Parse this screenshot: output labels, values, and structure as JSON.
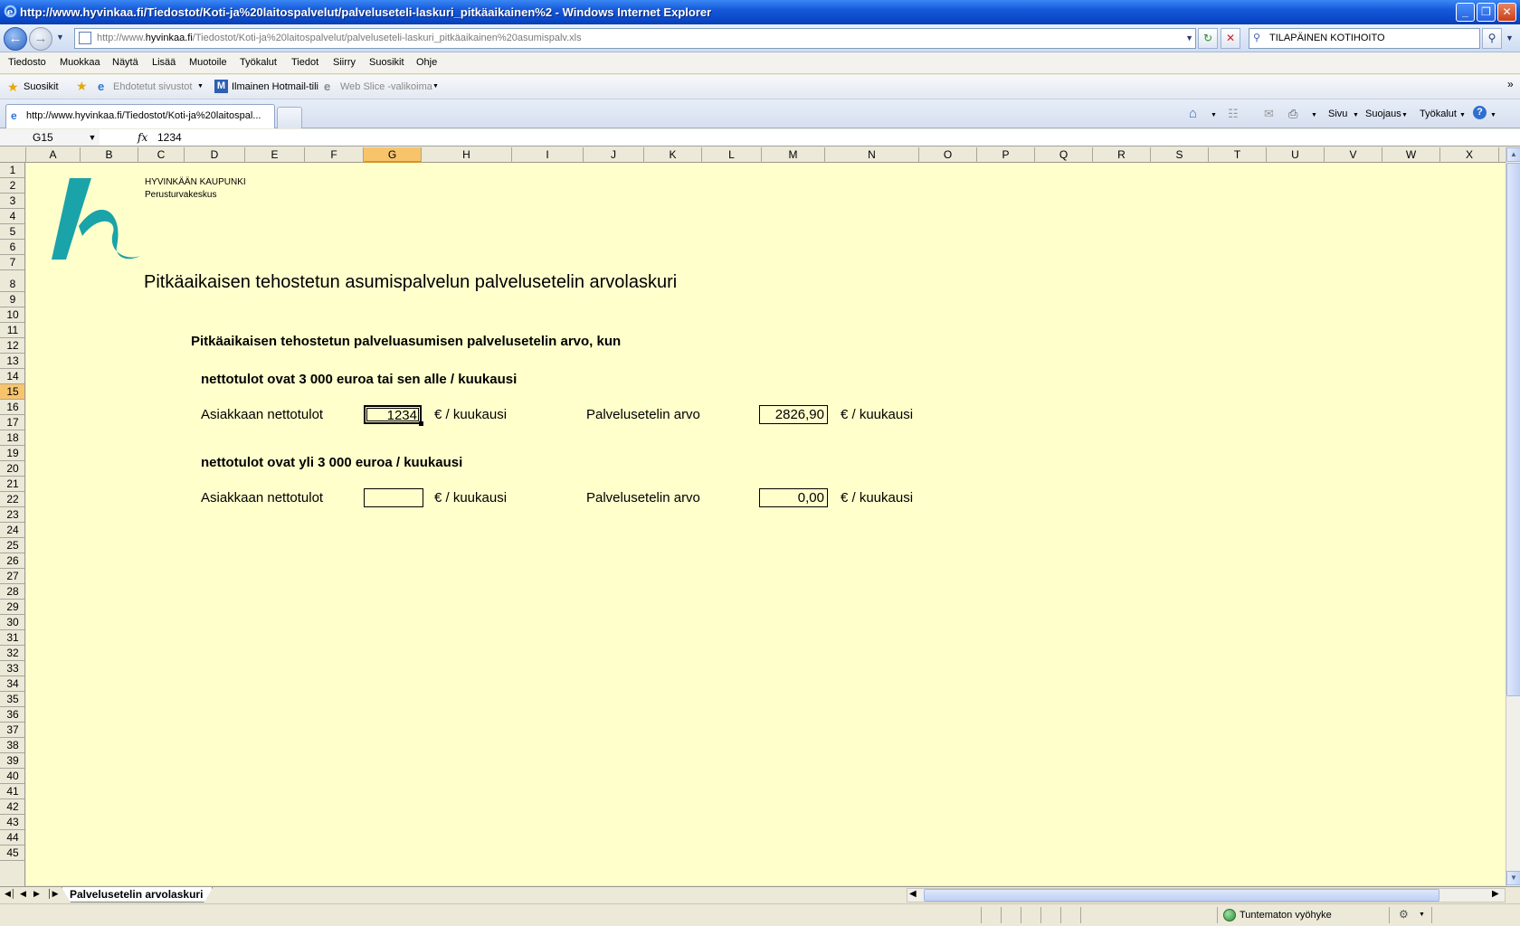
{
  "window": {
    "title": "http://www.hyvinkaa.fi/Tiedostot/Koti-ja%20laitospalvelut/palveluseteli-laskuri_pitkäaikainen%2 - Windows Internet Explorer",
    "minimize_glyph": "_",
    "maximize_glyph": "❐",
    "close_glyph": "✕"
  },
  "address": {
    "url_prefix": "http://www.",
    "url_domain": "hyvinkaa.fi",
    "url_path": "/Tiedostot/Koti-ja%20laitospalvelut/palveluseteli-laskuri_pitkäaikainen%20asumispalv.xls",
    "search_value": "TILAPÄINEN KOTIHOITO"
  },
  "menu": [
    "Tiedosto",
    "Muokkaa",
    "Näytä",
    "Lisää",
    "Muotoile",
    "Työkalut",
    "Tiedot",
    "Siirry",
    "Suosikit",
    "Ohje"
  ],
  "favorites": {
    "favorites_label": "Suosikit",
    "suggested_sites": "Ehdotetut sivustot",
    "hotmail": "Ilmainen Hotmail-tili",
    "web_slice": "Web Slice -valikoima"
  },
  "tab": {
    "active_label": "http://www.hyvinkaa.fi/Tiedostot/Koti-ja%20laitospal..."
  },
  "commandbar": {
    "page": "Sivu",
    "safety": "Suojaus",
    "tools": "Työkalut"
  },
  "formula": {
    "cell_ref": "G15",
    "fx": "fx",
    "value": "1234"
  },
  "columns": [
    "A",
    "B",
    "C",
    "D",
    "E",
    "F",
    "G",
    "H",
    "I",
    "J",
    "K",
    "L",
    "M",
    "N",
    "O",
    "P",
    "Q",
    "R",
    "S",
    "T",
    "U",
    "V",
    "W",
    "X"
  ],
  "selected_column": "G",
  "rows": [
    "1",
    "2",
    "3",
    "4",
    "5",
    "6",
    "7",
    "8",
    "9",
    "10",
    "11",
    "12",
    "13",
    "14",
    "15",
    "16",
    "17",
    "18",
    "19",
    "20",
    "21",
    "22",
    "23",
    "24",
    "25",
    "26",
    "27",
    "28",
    "29",
    "30",
    "31",
    "32",
    "33",
    "34",
    "35",
    "36",
    "37",
    "38",
    "39",
    "40",
    "41",
    "42",
    "43",
    "44",
    "45"
  ],
  "selected_row": "15",
  "sheet": {
    "org_name": "HYVINKÄÄN KAUPUNKI",
    "org_unit": "Perusturvakeskus",
    "title": "Pitkäaikaisen tehostetun asumispalvelun palvelusetelin arvolaskuri",
    "subtitle": "Pitkäaikaisen tehostetun palveluasumisen palvelusetelin arvo, kun",
    "section1_heading": "nettotulot ovat 3 000 euroa tai sen alle / kuukausi",
    "section2_heading": "nettotulot ovat yli 3 000 euroa / kuukausi",
    "net_income_label": "Asiakkaan nettotulot",
    "per_month": "€ / kuukausi",
    "voucher_value_label": "Palvelusetelin arvo",
    "s1_income_value": "1234",
    "s1_voucher_value": "2826,90",
    "s2_income_value": "",
    "s2_voucher_value": "0,00"
  },
  "sheet_tab": "Palvelusetelin arvolaskuri",
  "status": {
    "zone": "Tuntematon vyöhyke"
  },
  "colors": {
    "sheet_bg": "#ffffcc",
    "logo_teal": "#1aa3a8",
    "selection_header": "#f7c46c"
  }
}
